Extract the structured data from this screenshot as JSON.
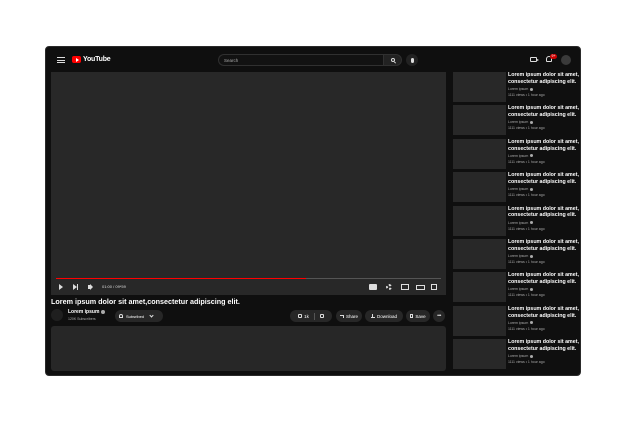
{
  "header": {
    "logo_text": "YouTube",
    "search_placeholder": "Search",
    "notification_count": "9+"
  },
  "player": {
    "time": "01:00 / 09*59",
    "progress": 0.65
  },
  "video": {
    "title": "Lorem ipsum dolor sit amet,consectetur adipiscing elit.",
    "channel": "Lorem ipsum",
    "subscribers": "120K Subscribers",
    "subscribed_label": "Subsribed",
    "like_count": "1k",
    "share_label": "Share",
    "download_label": "Download",
    "save_label": "Save",
    "more_label": "•••"
  },
  "recommendations": [
    {
      "title": "Lorem ipsum dolor sit amet, consectetur adipiscing elit.",
      "channel": "Lorem ipsum",
      "meta": "1111 views • 1 hour ago"
    },
    {
      "title": "Lorem ipsum dolor sit amet, consectetur adipiscing elit.",
      "channel": "Lorem ipsum",
      "meta": "1111 views • 1 hour ago"
    },
    {
      "title": "Lorem ipsum dolor sit amet, consectetur adipiscing elit.",
      "channel": "Lorem ipsum",
      "meta": "1111 views • 1 hour ago"
    },
    {
      "title": "Lorem ipsum dolor sit amet, consectetur adipiscing elit.",
      "channel": "Lorem ipsum",
      "meta": "1111 views • 1 hour ago"
    },
    {
      "title": "Lorem ipsum dolor sit amet, consectetur adipiscing elit.",
      "channel": "Lorem ipsum",
      "meta": "1111 views • 1 hour ago"
    },
    {
      "title": "Lorem ipsum dolor sit amet, consectetur adipiscing elit.",
      "channel": "Lorem ipsum",
      "meta": "1111 views • 1 hour ago"
    },
    {
      "title": "Lorem ipsum dolor sit amet, consectetur adipiscing elit.",
      "channel": "Lorem ipsum",
      "meta": "1111 views • 1 hour ago"
    },
    {
      "title": "Lorem ipsum dolor sit amet, consectetur adipiscing elit.",
      "channel": "Lorem ipsum",
      "meta": "1111 views • 1 hour ago"
    },
    {
      "title": "Lorem ipsum dolor sit amet, consectetur adipiscing elit.",
      "channel": "Lorem ipsum",
      "meta": "1111 views • 1 hour ago"
    }
  ]
}
